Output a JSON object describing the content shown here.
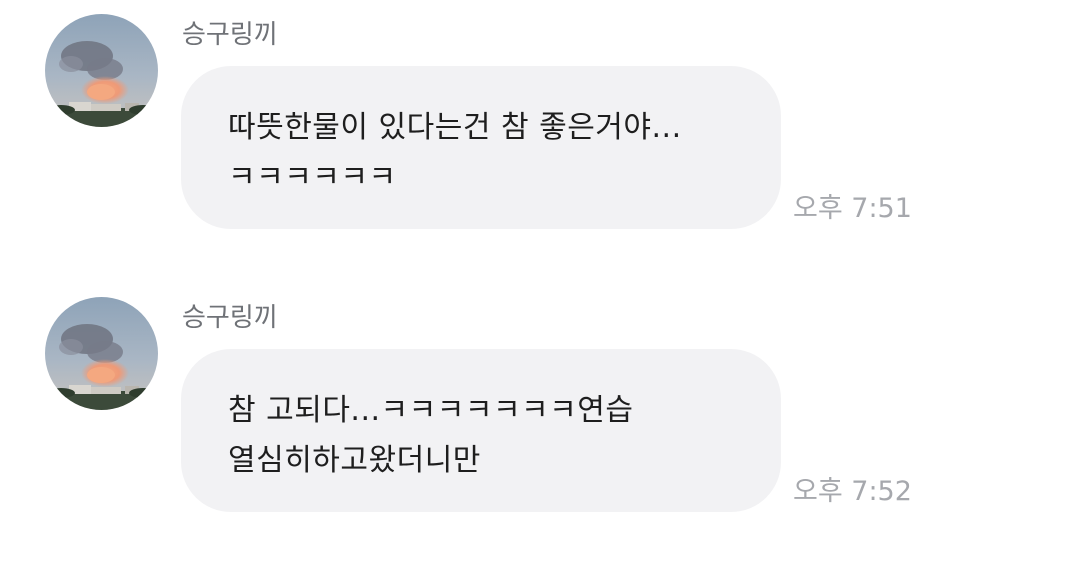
{
  "messages": [
    {
      "sender": "승구링끼",
      "lines": [
        "따뜻한물이 있다는건 참 좋은거야...",
        "ㅋㅋㅋㅋㅋㅋ"
      ],
      "time": "오후 7:51",
      "avatar_icon": "sky-cloud-avatar"
    },
    {
      "sender": "승구링끼",
      "lines": [
        "참 고되다...ㅋㅋㅋㅋㅋㅋㅋ연습",
        "열심히하고왔더니만"
      ],
      "time": "오후 7:52",
      "avatar_icon": "sky-cloud-avatar"
    }
  ],
  "colors": {
    "bubble": "#f2f2f4",
    "sender": "#6f7277",
    "time": "#a6a8ad",
    "text": "#1e1e1e"
  }
}
